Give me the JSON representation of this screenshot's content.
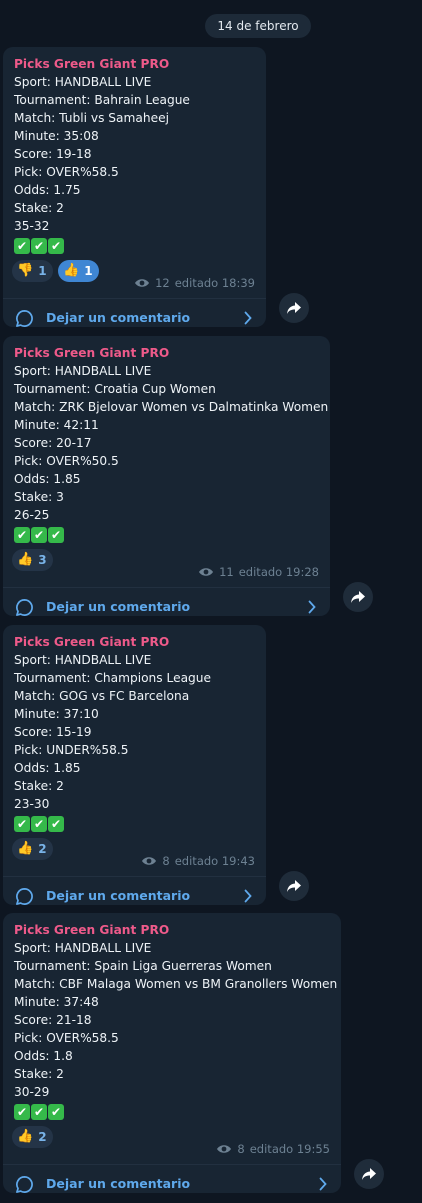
{
  "date_label": "14 de febrero",
  "comment_label": "Dejar un comentario",
  "messages": [
    {
      "title": "Picks Green Giant PRO",
      "sport": "Sport: HANDBALL LIVE",
      "tournament": "Tournament: Bahrain League",
      "match": "Match: Tubli vs Samaheej",
      "minute": "Minute: 35:08",
      "score": "Score: 19-18",
      "pick": "Pick: OVER%58.5",
      "odds": "Odds: 1.75",
      "stake": "Stake: 2",
      "result": "35-32",
      "checks": "✔✔✔",
      "reactions": [
        {
          "emoji": "thumbs-down",
          "count": "1",
          "selected": false
        },
        {
          "emoji": "thumbs-up",
          "count": "1",
          "selected": true
        }
      ],
      "views": "12",
      "edited": "editado 18:39"
    },
    {
      "title": "Picks Green Giant PRO",
      "sport": "Sport: HANDBALL LIVE",
      "tournament": "Tournament: Croatia Cup Women",
      "match": "Match: ZRK Bjelovar Women vs Dalmatinka Women",
      "minute": "Minute: 42:11",
      "score": "Score: 20-17",
      "pick": "Pick: OVER%50.5",
      "odds": "Odds: 1.85",
      "stake": "Stake: 3",
      "result": "26-25",
      "checks": "✔✔✔",
      "reactions": [
        {
          "emoji": "thumbs-up",
          "count": "3",
          "selected": false
        }
      ],
      "views": "11",
      "edited": "editado 19:28"
    },
    {
      "title": "Picks Green Giant PRO",
      "sport": "Sport: HANDBALL LIVE",
      "tournament": "Tournament: Champions League",
      "match": "Match: GOG vs FC Barcelona",
      "minute": "Minute: 37:10",
      "score": "Score: 15-19",
      "pick": "Pick: UNDER%58.5",
      "odds": "Odds: 1.85",
      "stake": "Stake: 2",
      "result": "23-30",
      "checks": "✔✔✔",
      "reactions": [
        {
          "emoji": "thumbs-up",
          "count": "2",
          "selected": false
        }
      ],
      "views": "8",
      "edited": "editado 19:43"
    },
    {
      "title": "Picks Green Giant PRO",
      "sport": "Sport: HANDBALL LIVE",
      "tournament": "Tournament: Spain Liga Guerreras Women",
      "match": "Match: CBF Malaga Women vs BM Granollers Women",
      "minute": "Minute: 37:48",
      "score": "Score: 21-18",
      "pick": "Pick: OVER%58.5",
      "odds": "Odds: 1.8",
      "stake": "Stake: 2",
      "result": "30-29",
      "checks": "✔✔✔",
      "reactions": [
        {
          "emoji": "thumbs-up",
          "count": "2",
          "selected": false
        }
      ],
      "views": "8",
      "edited": "editado 19:55"
    }
  ]
}
